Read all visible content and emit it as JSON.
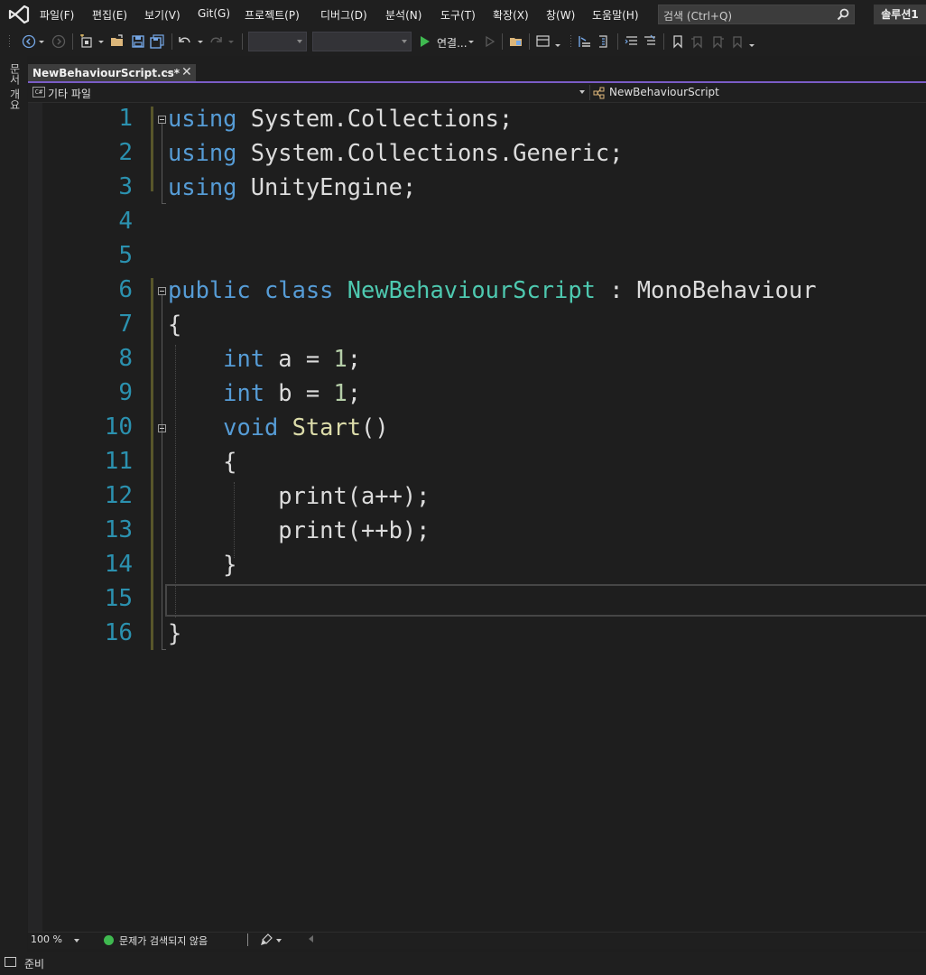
{
  "menu": [
    "파일(F)",
    "편집(E)",
    "보기(V)",
    "Git(G)",
    "프로젝트(P)",
    "디버그(D)",
    "분석(N)",
    "도구(T)",
    "확장(X)",
    "창(W)",
    "도움말(H)"
  ],
  "search": {
    "placeholder": "검색 (Ctrl+Q)"
  },
  "solution_name": "솔루션1",
  "toolbar": {
    "attach_label": "연결..."
  },
  "side_rail": {
    "label": "문서 개요"
  },
  "tab": {
    "title": "NewBehaviourScript.cs*",
    "pin": "⊸",
    "close": "✕"
  },
  "navbar": {
    "scope": "기타 파일",
    "class_name": "NewBehaviourScript"
  },
  "code": {
    "line_numbers": [
      "1",
      "2",
      "3",
      "4",
      "5",
      "6",
      "7",
      "8",
      "9",
      "10",
      "11",
      "12",
      "13",
      "14",
      "15",
      "16"
    ],
    "lines": [
      [
        {
          "t": "using",
          "c": "kw"
        },
        {
          "t": " System.Collections;",
          "c": ""
        }
      ],
      [
        {
          "t": "using",
          "c": "kw"
        },
        {
          "t": " System.Collections.Generic;",
          "c": ""
        }
      ],
      [
        {
          "t": "using",
          "c": "kw"
        },
        {
          "t": " UnityEngine;",
          "c": ""
        }
      ],
      [],
      [],
      [
        {
          "t": "public",
          "c": "kw"
        },
        {
          "t": " ",
          "c": ""
        },
        {
          "t": "class",
          "c": "kw"
        },
        {
          "t": " ",
          "c": ""
        },
        {
          "t": "NewBehaviourScript",
          "c": "ty"
        },
        {
          "t": " : MonoBehaviour",
          "c": ""
        }
      ],
      [
        {
          "t": "{",
          "c": ""
        }
      ],
      [
        {
          "t": "    ",
          "c": ""
        },
        {
          "t": "int",
          "c": "kw"
        },
        {
          "t": " a = ",
          "c": ""
        },
        {
          "t": "1",
          "c": "nm"
        },
        {
          "t": ";",
          "c": ""
        }
      ],
      [
        {
          "t": "    ",
          "c": ""
        },
        {
          "t": "int",
          "c": "kw"
        },
        {
          "t": " b = ",
          "c": ""
        },
        {
          "t": "1",
          "c": "nm"
        },
        {
          "t": ";",
          "c": ""
        }
      ],
      [
        {
          "t": "    ",
          "c": ""
        },
        {
          "t": "void",
          "c": "kw"
        },
        {
          "t": " ",
          "c": ""
        },
        {
          "t": "Start",
          "c": "fn"
        },
        {
          "t": "()",
          "c": ""
        }
      ],
      [
        {
          "t": "    {",
          "c": ""
        }
      ],
      [
        {
          "t": "        print(a++);",
          "c": ""
        }
      ],
      [
        {
          "t": "        print(++b);",
          "c": ""
        }
      ],
      [
        {
          "t": "    }",
          "c": ""
        }
      ],
      [],
      [
        {
          "t": "}",
          "c": ""
        }
      ]
    ]
  },
  "editor_status": {
    "zoom": "100 %",
    "issues": "문제가 검색되지 않음"
  },
  "status": {
    "text": "준비"
  },
  "colors": {
    "accent": "#7a5cc6",
    "line_number": "#2b91af",
    "keyword": "#569cd6",
    "type": "#4ec9b0",
    "function": "#dcdcaa",
    "number": "#b5cea8"
  }
}
